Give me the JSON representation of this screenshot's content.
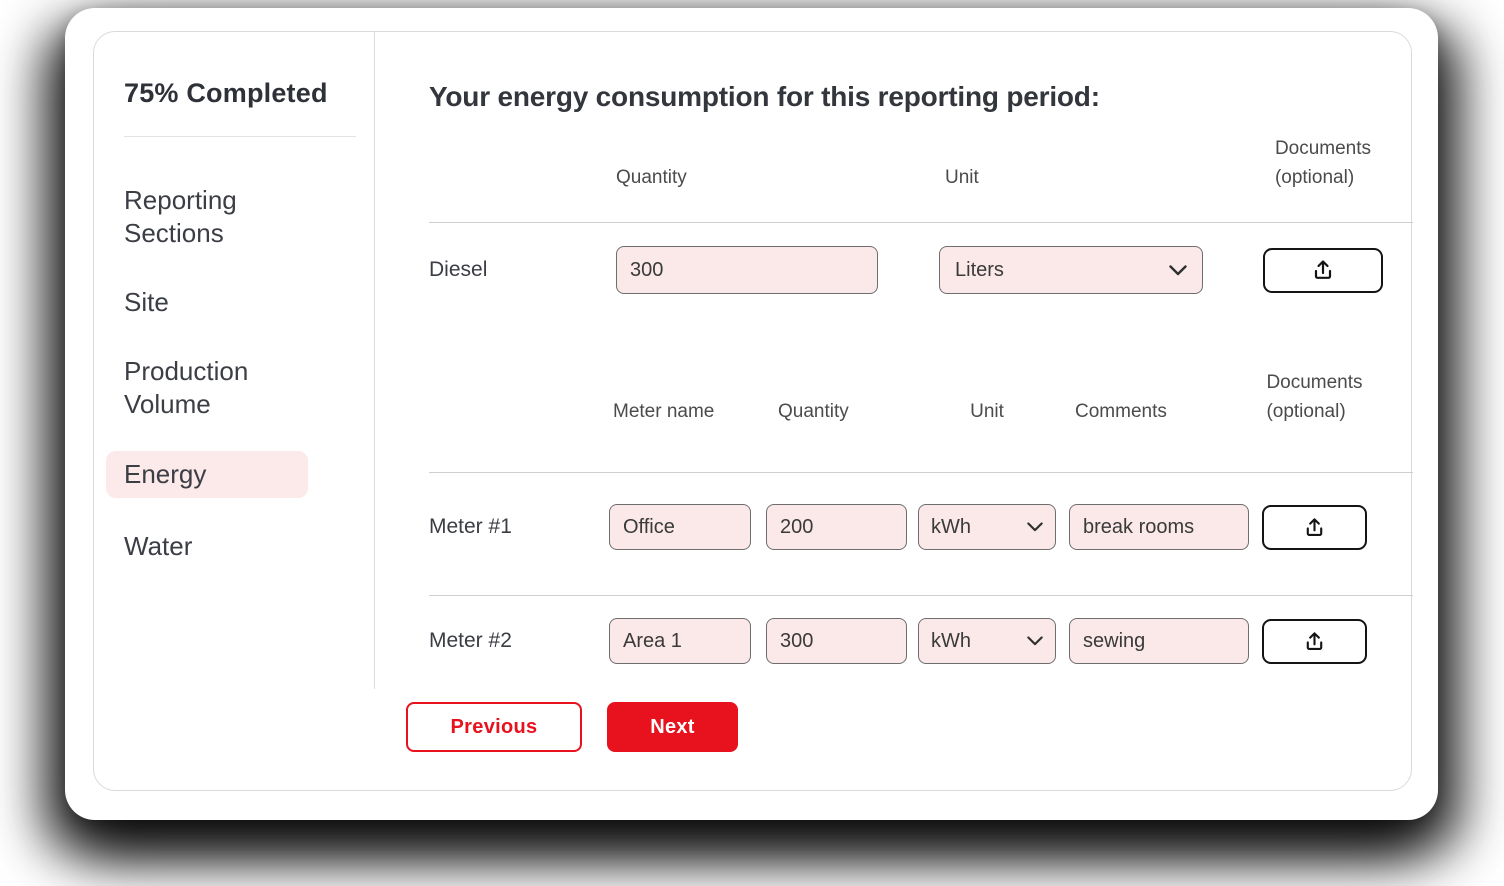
{
  "sidebar": {
    "progress_label": "75% Completed",
    "progress_percent": 75,
    "items": [
      {
        "label": "Reporting Sections",
        "active": false
      },
      {
        "label": "Site",
        "active": false
      },
      {
        "label": "Production Volume",
        "active": false
      },
      {
        "label": "Energy",
        "active": true
      },
      {
        "label": "Water",
        "active": false
      }
    ]
  },
  "main": {
    "title": "Your energy consumption for this reporting period:",
    "fuel_table": {
      "headers": {
        "quantity": "Quantity",
        "unit": "Unit",
        "documents_line1": "Documents",
        "documents_line2": "(optional)"
      },
      "rows": [
        {
          "label": "Diesel",
          "quantity": "300",
          "unit": "Liters"
        }
      ]
    },
    "meter_table": {
      "headers": {
        "meter_name": "Meter name",
        "quantity": "Quantity",
        "unit": "Unit",
        "comments": "Comments",
        "documents_line1": "Documents",
        "documents_line2": "(optional)"
      },
      "rows": [
        {
          "label": "Meter #1",
          "meter_name": "Office",
          "quantity": "200",
          "unit": "kWh",
          "comments": "break rooms"
        },
        {
          "label": "Meter #2",
          "meter_name": "Area 1",
          "quantity": "300",
          "unit": "kWh",
          "comments": "sewing"
        }
      ]
    },
    "actions": {
      "previous": "Previous",
      "next": "Next"
    }
  },
  "icons": {
    "upload": "upload-icon",
    "chevron_down": "chevron-down-icon"
  },
  "colors": {
    "accent_red": "#E8121E",
    "field_pink": "#FBE8E8",
    "active_item_pink": "#FCE9E9",
    "text_dark": "#33363C",
    "divider_gray": "#CFCFCF"
  }
}
